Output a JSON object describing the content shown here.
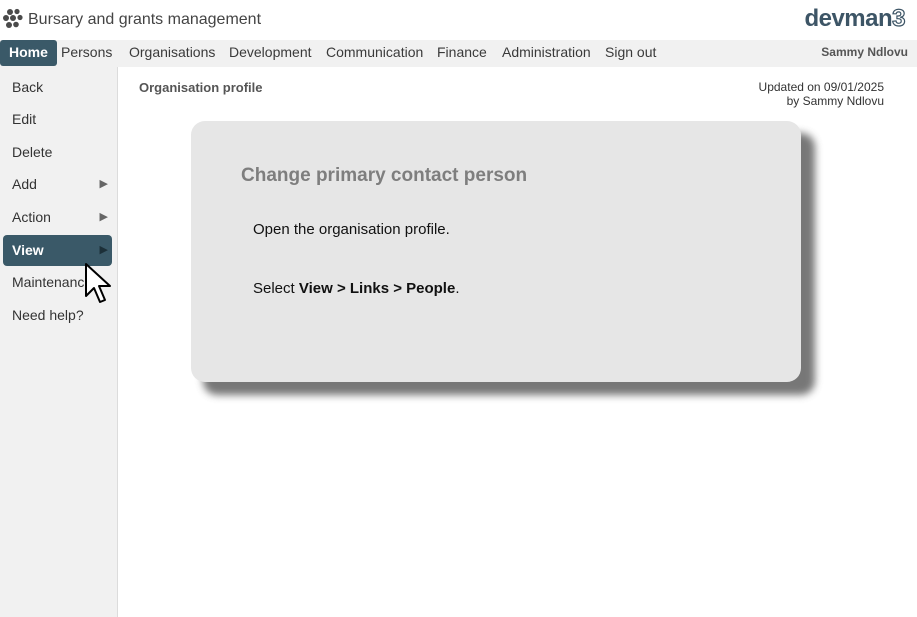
{
  "header": {
    "app_title": "Bursary and grants management",
    "brand_text": "devman",
    "brand_number": "3"
  },
  "nav": {
    "items": [
      {
        "label": "Home",
        "active": true
      },
      {
        "label": "Persons"
      },
      {
        "label": "Organisations"
      },
      {
        "label": "Development"
      },
      {
        "label": "Communication"
      },
      {
        "label": "Finance"
      },
      {
        "label": "Administration"
      },
      {
        "label": "Sign out"
      }
    ],
    "user": "Sammy Ndlovu"
  },
  "sidebar": {
    "items": [
      {
        "label": "Back"
      },
      {
        "label": "Edit"
      },
      {
        "label": "Delete"
      },
      {
        "label": "Add",
        "submenu": true
      },
      {
        "label": "Action",
        "submenu": true
      },
      {
        "label": "View",
        "submenu": true,
        "active": true
      },
      {
        "label": "Maintenance"
      },
      {
        "label": "Need help?"
      }
    ]
  },
  "main": {
    "page_title": "Organisation profile",
    "updated_line1": "Updated on 09/01/2025",
    "updated_line2": "by Sammy Ndlovu"
  },
  "card": {
    "title": "Change primary contact person",
    "step1": "Open the organisation profile.",
    "step2_prefix": "Select ",
    "step2_path": "View > Links > People",
    "step2_suffix": "."
  },
  "icons": {
    "submenu_arrow": "triangle-right",
    "logo": "dots-cluster",
    "cursor": "mouse-pointer"
  },
  "colors": {
    "accent": "#3a5968",
    "nav_bg": "#f1f1f1",
    "card_bg": "#e6e6e6",
    "card_title": "#7e7e7e"
  }
}
